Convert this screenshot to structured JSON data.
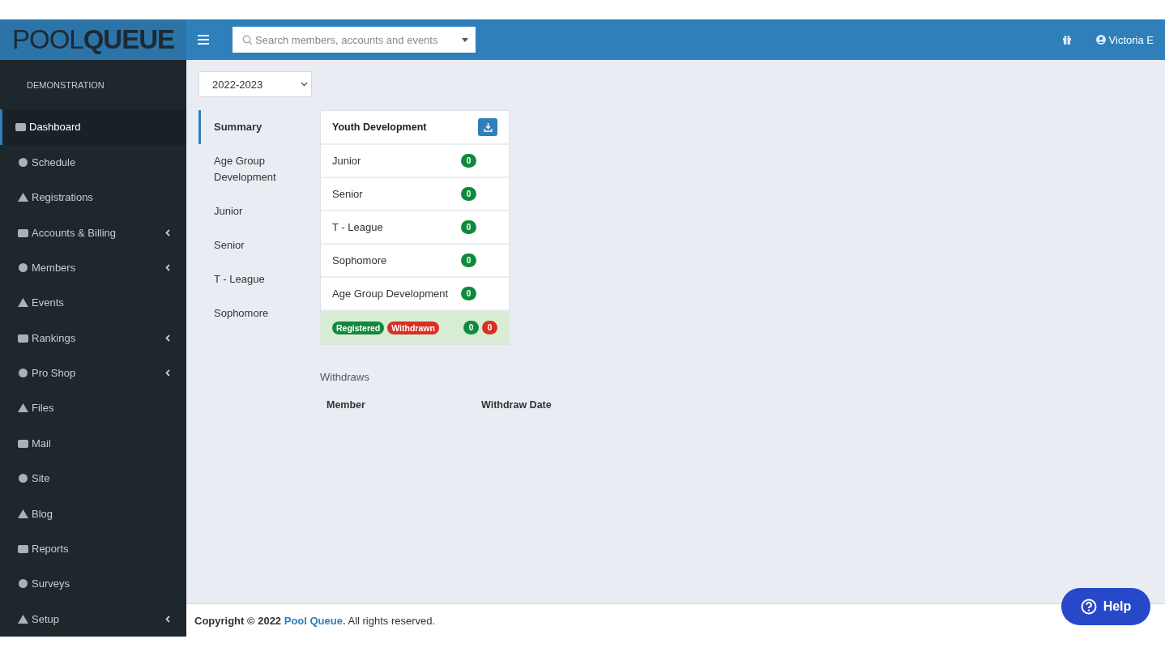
{
  "logo": {
    "light": "POOL",
    "bold": "QUEUE"
  },
  "search": {
    "placeholder": "Search members, accounts and events"
  },
  "user": {
    "name": "Victoria E"
  },
  "sidebar": {
    "org": "DEMONSTRATION",
    "items": [
      {
        "label": "Dashboard",
        "selected": true,
        "expandable": false
      },
      {
        "label": "Schedule",
        "selected": false,
        "expandable": false
      },
      {
        "label": "Registrations",
        "selected": false,
        "expandable": false
      },
      {
        "label": "Accounts & Billing",
        "selected": false,
        "expandable": true
      },
      {
        "label": "Members",
        "selected": false,
        "expandable": true
      },
      {
        "label": "Events",
        "selected": false,
        "expandable": false
      },
      {
        "label": "Rankings",
        "selected": false,
        "expandable": true
      },
      {
        "label": "Pro Shop",
        "selected": false,
        "expandable": true
      },
      {
        "label": "Files",
        "selected": false,
        "expandable": false
      },
      {
        "label": "Mail",
        "selected": false,
        "expandable": false
      },
      {
        "label": "Site",
        "selected": false,
        "expandable": false
      },
      {
        "label": "Blog",
        "selected": false,
        "expandable": false
      },
      {
        "label": "Reports",
        "selected": false,
        "expandable": false
      },
      {
        "label": "Surveys",
        "selected": false,
        "expandable": false
      },
      {
        "label": "Setup",
        "selected": false,
        "expandable": true
      }
    ]
  },
  "season": {
    "value": "2022-2023"
  },
  "subnav": [
    {
      "label": "Summary",
      "selected": true
    },
    {
      "label": "Age Group Development",
      "selected": false
    },
    {
      "label": "Junior",
      "selected": false
    },
    {
      "label": "Senior",
      "selected": false
    },
    {
      "label": "T - League",
      "selected": false
    },
    {
      "label": "Sophomore",
      "selected": false
    }
  ],
  "card": {
    "title": "Youth Development",
    "rows": [
      {
        "label": "Junior",
        "count": "0"
      },
      {
        "label": "Senior",
        "count": "0"
      },
      {
        "label": "T - League",
        "count": "0"
      },
      {
        "label": "Sophomore",
        "count": "0"
      },
      {
        "label": "Age Group Development",
        "count": "0"
      }
    ],
    "legend": [
      {
        "label": "Registered",
        "color": "#0f8a3c"
      },
      {
        "label": "Withdrawn",
        "color": "#d93025"
      }
    ],
    "totals": [
      {
        "count": "0",
        "color": "#0f8a3c"
      },
      {
        "count": "0",
        "color": "#d93025"
      }
    ]
  },
  "withdraws": {
    "title": "Withdraws",
    "columns": [
      "Member",
      "Withdraw Date"
    ]
  },
  "footer": {
    "prefix": "Copyright © 2022",
    "link": "Pool Queue.",
    "suffix": "All rights reserved."
  },
  "help": {
    "label": "Help"
  }
}
